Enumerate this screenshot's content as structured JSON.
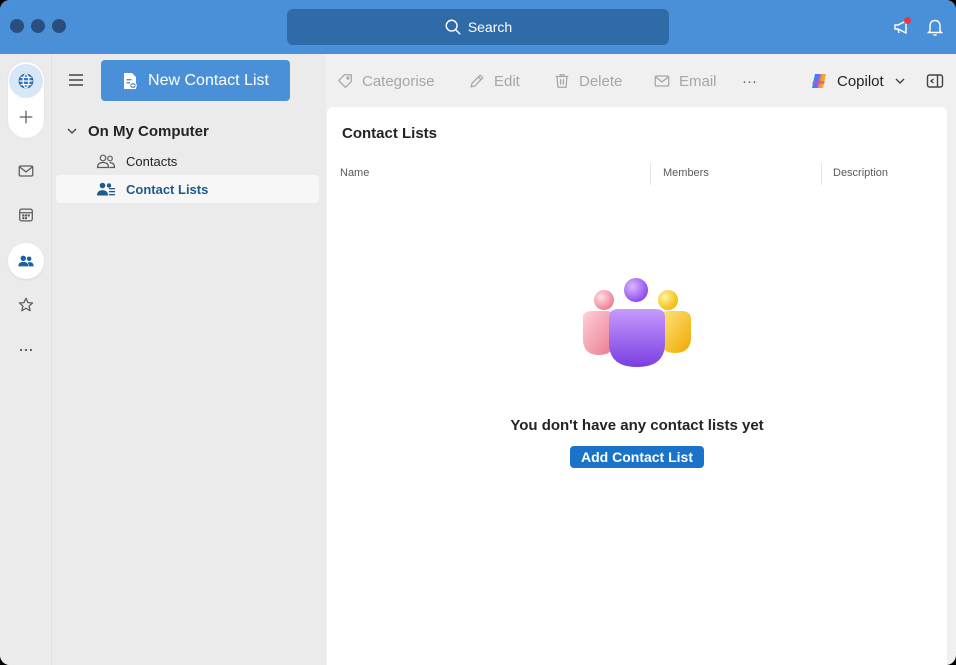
{
  "titlebar": {
    "search_label": "Search"
  },
  "sidebar": {
    "new_button_label": "New Contact List",
    "tree_header": "On My Computer",
    "items": [
      {
        "label": "Contacts"
      },
      {
        "label": "Contact Lists"
      }
    ]
  },
  "toolbar": {
    "categorise": "Categorise",
    "edit": "Edit",
    "delete": "Delete",
    "email": "Email",
    "more": "···",
    "copilot": "Copilot"
  },
  "content": {
    "title": "Contact Lists",
    "columns": [
      "Name",
      "Members",
      "Description"
    ],
    "empty_message": "You don't have any contact lists yet",
    "add_button_label": "Add Contact List"
  },
  "colors": {
    "titlebar": "#4a90d9",
    "accent_button": "#4a90d9",
    "primary_action": "#1a73c8",
    "selected_text": "#1e5a8e",
    "notification_dot": "#e53946"
  },
  "icons": [
    "search-icon",
    "megaphone-icon",
    "bell-icon",
    "globe-icon",
    "plus-icon",
    "mail-icon",
    "calendar-icon",
    "people-icon",
    "star-icon",
    "more-icon",
    "hamburger-icon",
    "new-contact-list-icon",
    "chevron-down-icon",
    "contacts-icon",
    "contact-lists-icon",
    "tag-icon",
    "pencil-icon",
    "trash-icon",
    "envelope-icon",
    "copilot-icon",
    "panel-toggle-icon"
  ]
}
